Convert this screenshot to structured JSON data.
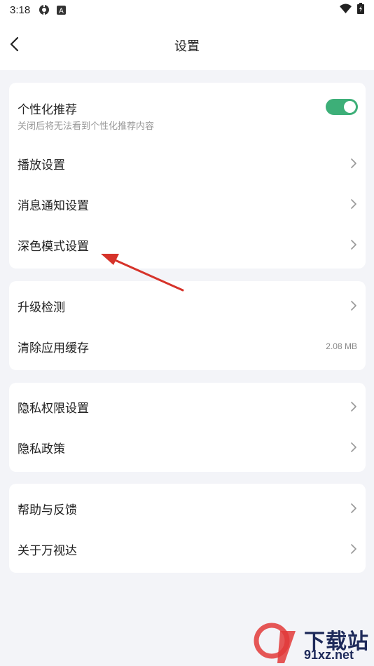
{
  "status_bar": {
    "time": "3:18",
    "left_icons": [
      "sync-icon",
      "app-a-icon"
    ],
    "right_icons": [
      "wifi-icon",
      "battery-icon"
    ]
  },
  "header": {
    "title": "设置",
    "back_icon": "chevron-left-icon"
  },
  "colors": {
    "accent": "#3daf78",
    "background": "#f3f4f8",
    "card": "#ffffff",
    "annotation_arrow": "#d6332a"
  },
  "groups": {
    "personal": {
      "toggle": {
        "label": "个性化推荐",
        "subtitle": "关闭后将无法看到个性化推荐内容",
        "state": "on"
      },
      "items": [
        {
          "label": "播放设置"
        },
        {
          "label": "消息通知设置"
        },
        {
          "label": "深色模式设置"
        }
      ]
    },
    "system": {
      "items": [
        {
          "label": "升级检测"
        },
        {
          "label": "清除应用缓存",
          "value": "2.08 MB"
        }
      ]
    },
    "privacy": {
      "items": [
        {
          "label": "隐私权限设置"
        },
        {
          "label": "隐私政策"
        }
      ]
    },
    "about": {
      "items": [
        {
          "label": "帮助与反馈"
        },
        {
          "label": "关于万视达"
        }
      ]
    }
  },
  "watermark": {
    "text": "下载站",
    "url": "91xz.net"
  }
}
